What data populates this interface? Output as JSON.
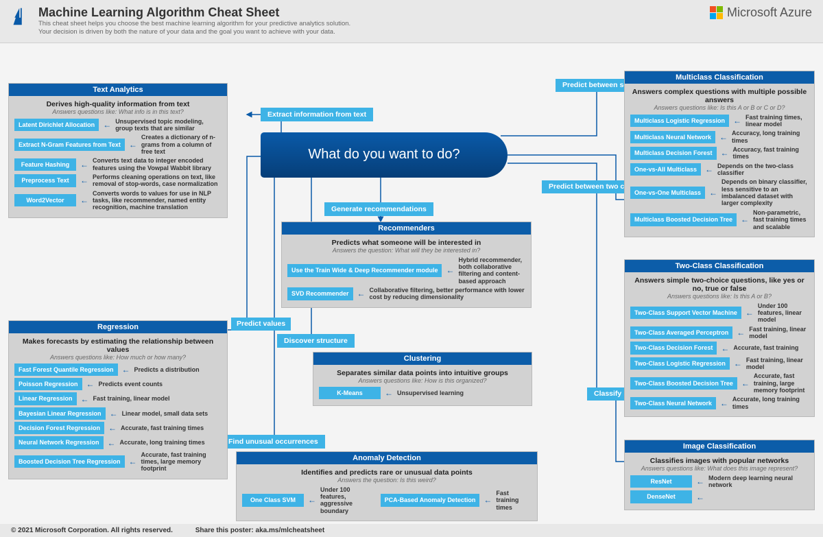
{
  "header": {
    "title": "Machine Learning Algorithm Cheat Sheet",
    "desc1": "This cheat sheet helps you choose the best machine learning algorithm for your predictive analytics solution.",
    "desc2": "Your decision is driven by both the nature of your data and the goal you want to achieve with your data.",
    "brand": "Microsoft Azure"
  },
  "hub": "What do you want to do?",
  "actions": {
    "extract": "Extract information from text",
    "predictCategories": "Predict between several categories",
    "predictTwo": "Predict between two categories",
    "recommend": "Generate recommendations",
    "predictValues": "Predict values",
    "structure": "Discover structure",
    "unusual": "Find unusual occurrences",
    "classifyImg": "Classify images"
  },
  "textAnalytics": {
    "title": "Text Analytics",
    "sub": "Derives high-quality information from text",
    "q": "Answers questions like: What info is in this text?",
    "algos": [
      {
        "n": "Latent Dirichlet Allocation",
        "d": "Unsupervised topic modeling, group texts that are similar"
      },
      {
        "n": "Extract N-Gram Features from Text",
        "d": "Creates a dictionary of n-grams from a column of free text"
      },
      {
        "n": "Feature Hashing",
        "d": "Converts text data to integer encoded features using the Vowpal Wabbit library"
      },
      {
        "n": "Preprocess Text",
        "d": "Performs cleaning operations on text, like removal of stop-words, case normalization"
      },
      {
        "n": "Word2Vector",
        "d": "Converts words to values for use in NLP tasks, like recommender, named entity recognition, machine translation"
      }
    ]
  },
  "regression": {
    "title": "Regression",
    "sub": "Makes forecasts by estimating the relationship between values",
    "q": "Answers questions like: How much or how many?",
    "algos": [
      {
        "n": "Fast Forest Quantile Regression",
        "d": "Predicts a distribution"
      },
      {
        "n": "Poisson Regression",
        "d": "Predicts event counts"
      },
      {
        "n": "Linear Regression",
        "d": "Fast training, linear model"
      },
      {
        "n": "Bayesian Linear Regression",
        "d": "Linear model, small data sets"
      },
      {
        "n": "Decision Forest Regression",
        "d": "Accurate, fast training times"
      },
      {
        "n": "Neural Network Regression",
        "d": "Accurate, long training times"
      },
      {
        "n": "Boosted Decision Tree Regression",
        "d": "Accurate, fast training times, large memory footprint"
      }
    ]
  },
  "recommenders": {
    "title": "Recommenders",
    "sub": "Predicts what someone will be interested in",
    "q": "Answers the question: What will they be interested in?",
    "algos": [
      {
        "n": "Use the Train Wide & Deep Recommender module",
        "d": "Hybrid recommender, both collaborative filtering and content-based approach"
      },
      {
        "n": "SVD Recommender",
        "d": "Collaborative filtering, better performance with lower cost by reducing dimensionality"
      }
    ]
  },
  "clustering": {
    "title": "Clustering",
    "sub": "Separates similar data points into intuitive groups",
    "q": "Answers questions like: How is this organized?",
    "algos": [
      {
        "n": "K-Means",
        "d": "Unsupervised learning"
      }
    ]
  },
  "anomaly": {
    "title": "Anomaly Detection",
    "sub": "Identifies and predicts rare or unusual data points",
    "q": "Answers the question: Is this weird?",
    "algos": [
      {
        "n": "One Class SVM",
        "d": "Under 100 features, aggressive boundary"
      },
      {
        "n": "PCA-Based Anomaly Detection",
        "d": "Fast training times"
      }
    ]
  },
  "multiclass": {
    "title": "Multiclass Classification",
    "sub": "Answers complex questions with multiple possible answers",
    "q": "Answers questions like: Is this A or B or C or D?",
    "algos": [
      {
        "n": "Multiclass Logistic Regression",
        "d": "Fast training times, linear model"
      },
      {
        "n": "Multiclass Neural Network",
        "d": "Accuracy, long training times"
      },
      {
        "n": "Multiclass Decision Forest",
        "d": "Accuracy, fast training times"
      },
      {
        "n": "One-vs-All Multiclass",
        "d": "Depends on the two-class classifier"
      },
      {
        "n": "One-vs-One Multiclass",
        "d": "Depends on binary classifier, less sensitive to an imbalanced dataset with larger complexity"
      },
      {
        "n": "Multiclass Boosted Decision Tree",
        "d": "Non-parametric, fast training times and scalable"
      }
    ]
  },
  "twoclass": {
    "title": "Two-Class Classification",
    "sub": "Answers simple two-choice questions, like yes or no, true or false",
    "q": "Answers questions like: Is this A or B?",
    "algos": [
      {
        "n": "Two-Class Support Vector Machine",
        "d": "Under 100 features, linear model"
      },
      {
        "n": "Two-Class Averaged Perceptron",
        "d": "Fast training, linear model"
      },
      {
        "n": "Two-Class Decision Forest",
        "d": "Accurate, fast training"
      },
      {
        "n": "Two-Class Logistic Regression",
        "d": "Fast training, linear model"
      },
      {
        "n": "Two-Class Boosted Decision Tree",
        "d": "Accurate, fast training, large memory footprint"
      },
      {
        "n": "Two-Class Neural Network",
        "d": "Accurate, long training times"
      }
    ]
  },
  "image": {
    "title": "Image Classification",
    "sub": "Classifies images with popular networks",
    "q": "Answers questions like: What does this image represent?",
    "algos": [
      {
        "n": "ResNet",
        "d": "Modern deep learning neural network"
      },
      {
        "n": "DenseNet",
        "d": ""
      }
    ]
  },
  "footer": {
    "copyright": "© 2021 Microsoft Corporation. All rights reserved.",
    "share": "Share this poster: aka.ms/mlcheatsheet"
  }
}
